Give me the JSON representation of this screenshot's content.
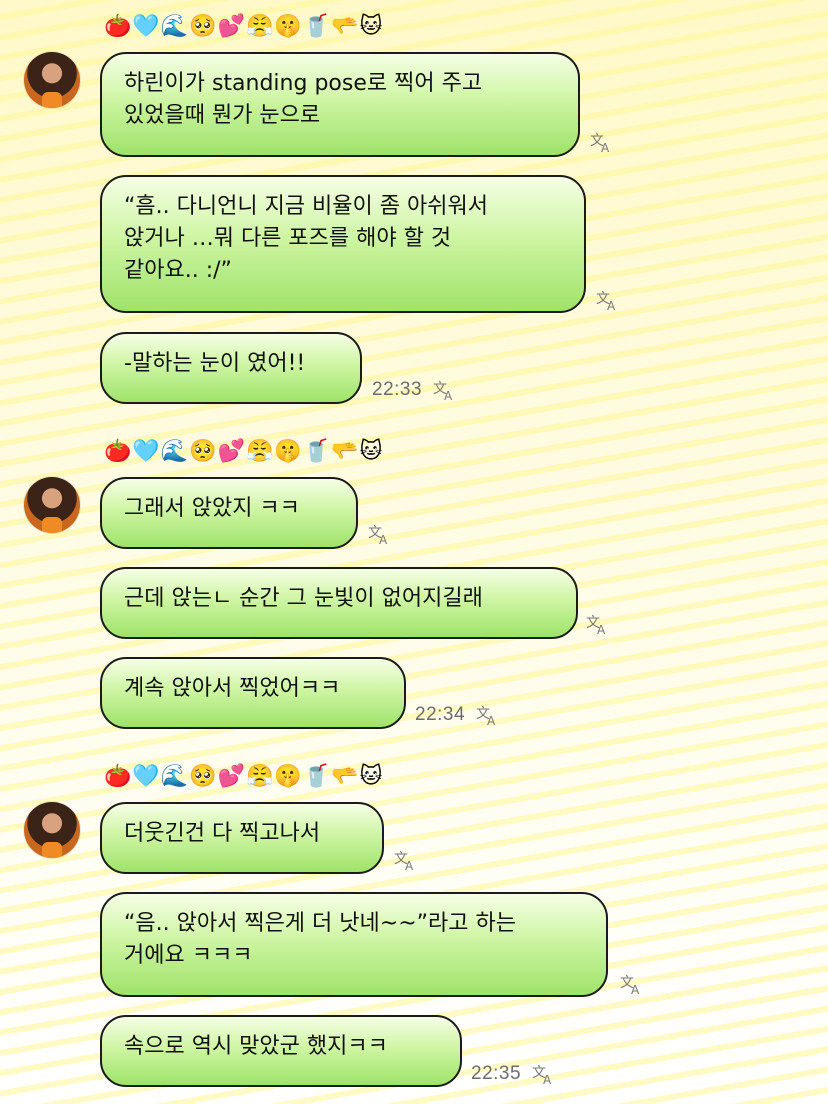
{
  "sender_name": "🍅🩵🌊🥺💕😤🤫🥤🫳🐱",
  "groups": [
    {
      "messages": [
        {
          "text": "하린이가 standing pose로 찍어 주고\n있었을때 뭔가 눈으로",
          "time": ""
        },
        {
          "text": "“흠.. 다니언니 지금 비율이 좀 아쉬워서\n앉거나 …뭐 다른 포즈를 해야 할 것\n같아요..  :/”",
          "time": ""
        },
        {
          "text": "-말하는 눈이 였어!!",
          "time": "22:33"
        }
      ]
    },
    {
      "messages": [
        {
          "text": "그래서 앉았지 ㅋㅋ",
          "time": ""
        },
        {
          "text": "근데 앉는ㄴ 순간 그 눈빛이 없어지길래",
          "time": ""
        },
        {
          "text": "계속 앉아서 찍었어ㅋㅋ",
          "time": "22:34"
        }
      ]
    },
    {
      "messages": [
        {
          "text": "더웃긴건 다 찍고나서",
          "time": ""
        },
        {
          "text": "“음.. 앉아서 찍은게 더 낫네~~”라고 하는\n거에요 ㅋㅋㅋ",
          "time": ""
        },
        {
          "text": "속으로 역시 맞았군 했지ㅋㅋ",
          "time": "22:35"
        }
      ]
    }
  ]
}
